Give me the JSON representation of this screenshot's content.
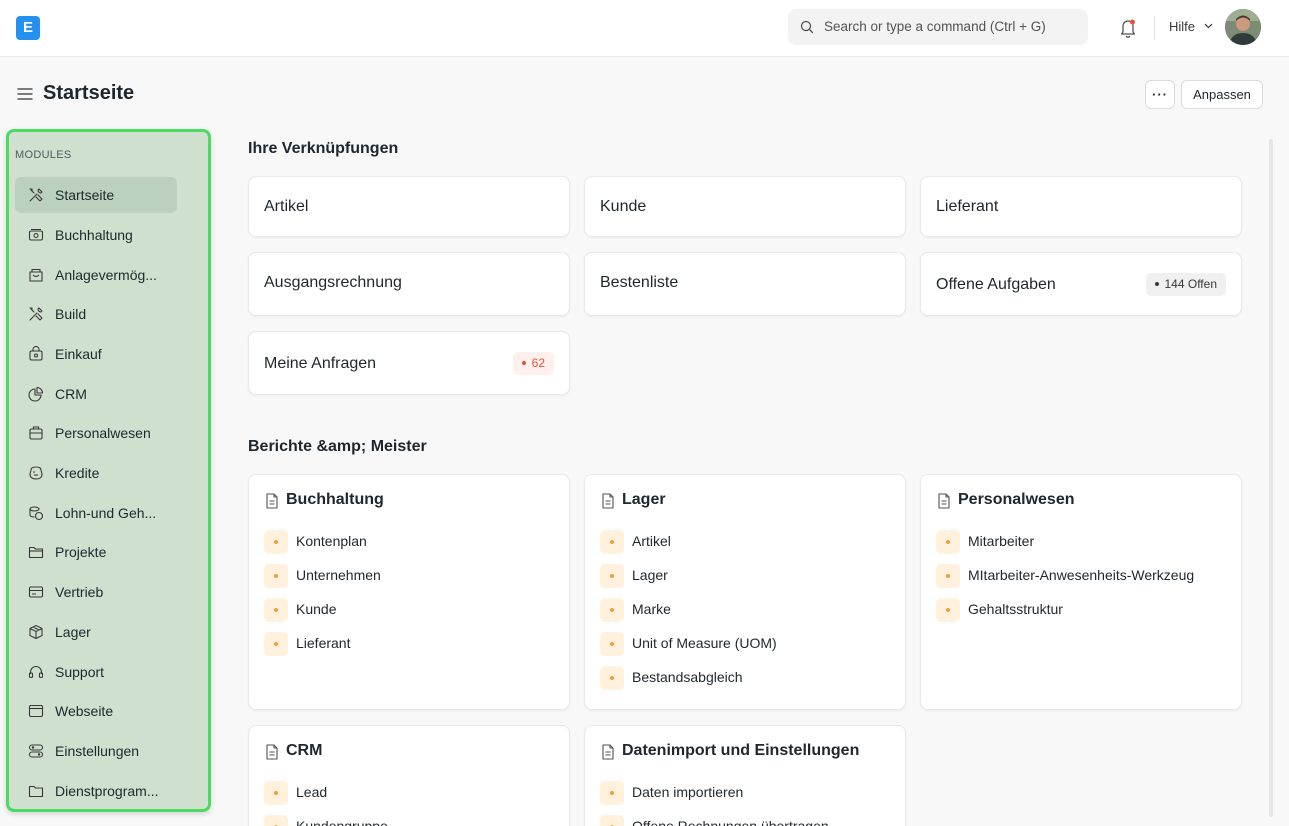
{
  "app": {
    "logo_letter": "E"
  },
  "navbar": {
    "search_placeholder": "Search or type a command (Ctrl + G)",
    "help_label": "Hilfe"
  },
  "page": {
    "title": "Startseite",
    "more_label": "···",
    "customize_label": "Anpassen"
  },
  "sidebar": {
    "heading": "MODULES",
    "items": [
      {
        "label": "Startseite",
        "icon": "tools-icon"
      },
      {
        "label": "Buchhaltung",
        "icon": "accounting-icon"
      },
      {
        "label": "Anlagevermög...",
        "icon": "assets-icon"
      },
      {
        "label": "Build",
        "icon": "tools-icon"
      },
      {
        "label": "Einkauf",
        "icon": "buying-icon"
      },
      {
        "label": "CRM",
        "icon": "crm-icon"
      },
      {
        "label": "Personalwesen",
        "icon": "hr-icon"
      },
      {
        "label": "Kredite",
        "icon": "loan-icon"
      },
      {
        "label": "Lohn-und Geh...",
        "icon": "payroll-icon"
      },
      {
        "label": "Projekte",
        "icon": "folder-icon"
      },
      {
        "label": "Vertrieb",
        "icon": "selling-icon"
      },
      {
        "label": "Lager",
        "icon": "stock-icon"
      },
      {
        "label": "Support",
        "icon": "headset-icon"
      },
      {
        "label": "Webseite",
        "icon": "website-icon"
      },
      {
        "label": "Einstellungen",
        "icon": "settings-icon"
      },
      {
        "label": "Dienstprogram...",
        "icon": "folder-icon"
      }
    ]
  },
  "shortcuts": {
    "title": "Ihre Verknüpfungen",
    "items": [
      {
        "label": "Artikel"
      },
      {
        "label": "Kunde"
      },
      {
        "label": "Lieferant"
      },
      {
        "label": "Ausgangsrechnung"
      },
      {
        "label": "Bestenliste"
      },
      {
        "label": "Offene Aufgaben",
        "badge": "144 Offen"
      },
      {
        "label": "Meine Anfragen",
        "badge": "62"
      }
    ]
  },
  "reports": {
    "title": "Berichte &amp; Meister",
    "cards": [
      {
        "title": "Buchhaltung",
        "links": [
          "Kontenplan",
          "Unternehmen",
          "Kunde",
          "Lieferant"
        ]
      },
      {
        "title": "Lager",
        "links": [
          "Artikel",
          "Lager",
          "Marke",
          "Unit of Measure (UOM)",
          "Bestandsabgleich"
        ]
      },
      {
        "title": "Personalwesen",
        "links": [
          "Mitarbeiter",
          "MItarbeiter-Anwesenheits-Werkzeug",
          "Gehaltsstruktur"
        ]
      },
      {
        "title": "CRM",
        "links": [
          "Lead",
          "Kundengruppe"
        ]
      },
      {
        "title": "Datenimport und Einstellungen",
        "links": [
          "Daten importieren",
          "Offene Rechnungen übertragen"
        ]
      }
    ]
  },
  "colors": {
    "logo": "#2490ef",
    "sidebar_bg": "#cfe0cf",
    "sidebar_border": "#4cd964",
    "badge_red": "#e2543a",
    "link_dot": "#f0a13b"
  }
}
